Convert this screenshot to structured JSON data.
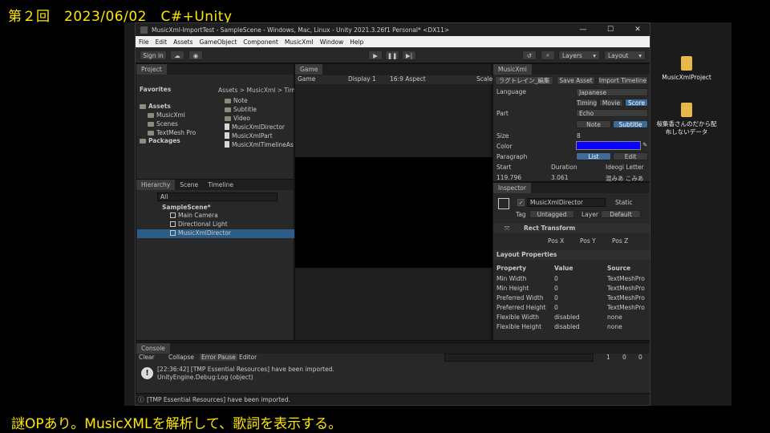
{
  "overlay": {
    "title": "第２回　2023/06/02　C#+Unity",
    "subtitle": "謎OPあり。MusicXMLを解析して、歌詞を表示する。"
  },
  "window": {
    "title": "MusicXml-ImportTest - SampleScene - Windows, Mac, Linux - Unity 2021.3.26f1 Personal* <DX11>",
    "controls": [
      "—",
      "☐",
      "✕"
    ]
  },
  "menu": [
    "File",
    "Edit",
    "Assets",
    "GameObject",
    "Component",
    "MusicXml",
    "Window",
    "Help"
  ],
  "toolbar": {
    "signin": "Sign in",
    "layers": "Layers",
    "layout": "Layout"
  },
  "project": {
    "tab": "Project",
    "favorites": "Favorites",
    "assets": "Assets",
    "tree": [
      "MusicXml",
      "Scenes",
      "TextMesh Pro"
    ],
    "packages": "Packages",
    "breadcrumb": [
      "Assets",
      "MusicXml",
      "Tim"
    ],
    "files": [
      "Note",
      "Subtitle",
      "Video",
      "MusicXmlDirector",
      "MusicXmlPart",
      "MusicXmlTimelineAs"
    ]
  },
  "hierarchy": {
    "tabs": [
      "Hierarchy",
      "Scene",
      "Timeline"
    ],
    "search": "All",
    "scene": "SampleScene*",
    "items": [
      "Main Camera",
      "Directional Light",
      "MusicXmlDirector"
    ]
  },
  "game": {
    "tab": "Game",
    "mode": "Game",
    "display": "Display 1",
    "aspect": "16:9 Aspect",
    "scale": "Scale"
  },
  "musicxml": {
    "tab": "MusicXml",
    "dropdown": "ラグトレイン_編集",
    "save": "Save Asset",
    "import": "Import Timeline",
    "language_label": "Language",
    "language": "Japanese",
    "modes": [
      "Timing",
      "Movie",
      "Score"
    ],
    "part_label": "Part",
    "part": "Echo",
    "views": [
      "Note",
      "Subtitle"
    ],
    "size_label": "Size",
    "size": "8",
    "color_label": "Color",
    "color": "#0a00ff",
    "paragraph_label": "Paragraph",
    "paragraph_btns": [
      "List",
      "Edit"
    ],
    "cols": [
      "Start",
      "Duration",
      "Ideogi Letter"
    ],
    "row": [
      "119.796",
      "3.061",
      "混みあ こみあ"
    ]
  },
  "inspector": {
    "tab": "Inspector",
    "name": "MusicXmlDirector",
    "static": "Static",
    "tag_label": "Tag",
    "tag": "Untagged",
    "layer_label": "Layer",
    "layer": "Default",
    "component": "Rect Transform",
    "pos": [
      "Pos X",
      "Pos Y",
      "Pos Z"
    ],
    "layout_title": "Layout Properties",
    "headers": [
      "Property",
      "Value",
      "Source"
    ],
    "rows": [
      [
        "Min Width",
        "0",
        "TextMeshPro"
      ],
      [
        "Min Height",
        "0",
        "TextMeshPro"
      ],
      [
        "Preferred Width",
        "0",
        "TextMeshPro"
      ],
      [
        "Preferred Height",
        "0",
        "TextMeshPro"
      ],
      [
        "Flexible Width",
        "disabled",
        "none"
      ],
      [
        "Flexible Height",
        "disabled",
        "none"
      ]
    ]
  },
  "console": {
    "tab": "Console",
    "clear": "Clear",
    "collapse": "Collapse",
    "errorpause": "Error Pause",
    "editor": "Editor",
    "counts": [
      "1",
      "0",
      "0"
    ],
    "msg1": "[22:36:42] [TMP Essential Resources] have been imported.",
    "msg2": "UnityEngine.Debug:Log (object)",
    "status": "[TMP Essential Resources] have been imported."
  },
  "desktop": {
    "icon1": "MusicXmlProject",
    "icon2": "桜集香さんのだから配布しないデータ"
  }
}
